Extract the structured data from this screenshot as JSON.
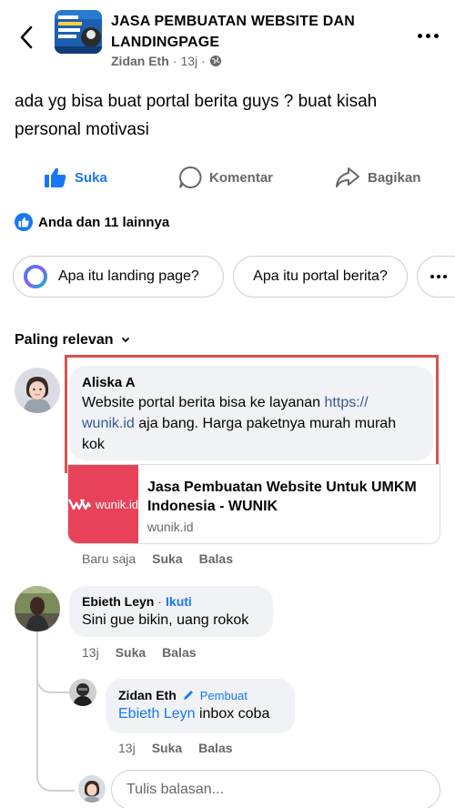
{
  "header": {
    "group_name": "JASA PEMBUATAN WEBSITE DAN LANDINGPAGE",
    "thumb_text": "JASA PEMBUATAN LANDING PAGE",
    "author": "Zidan Eth",
    "time": "13j",
    "privacy_icon": "globe-icon"
  },
  "post": {
    "text": "ada yg bisa buat portal berita guys ? buat kisah personal motivasi"
  },
  "actions": {
    "like": "Suka",
    "comment": "Komentar",
    "share": "Bagikan"
  },
  "reactions": {
    "summary": "Anda dan 11 lainnya"
  },
  "chips": [
    {
      "label": "Apa itu landing page?"
    },
    {
      "label": "Apa itu portal berita?"
    }
  ],
  "sort": {
    "label": "Paling relevan"
  },
  "comments": [
    {
      "name": "Aliska A",
      "text_before": "Website portal berita bisa ke layanan ",
      "link_text": "https:// wunik.id",
      "text_after": " aja bang. Harga paketnya murah murah kok",
      "card": {
        "brand": "wunik.id",
        "title": "Jasa Pembuatan Website Untuk UMKM Indonesia - WUNIK",
        "domain": "wunik.id"
      },
      "time": "Baru saja",
      "like": "Suka",
      "reply": "Balas"
    },
    {
      "name": "Ebieth Leyn",
      "follow": "Ikuti",
      "text": "Sini gue bikin, uang rokok",
      "time": "13j",
      "like": "Suka",
      "reply": "Balas"
    },
    {
      "name": "Zidan Eth",
      "badge": "Pembuat",
      "mention": "Ebieth Leyn",
      "text": " inbox coba",
      "time": "13j",
      "like": "Suka",
      "reply": "Balas"
    }
  ],
  "reply_box": {
    "placeholder": "Tulis balasan..."
  },
  "colors": {
    "accent": "#1877f2",
    "highlight": "#d9534f",
    "brand_card": "#e8425b"
  }
}
